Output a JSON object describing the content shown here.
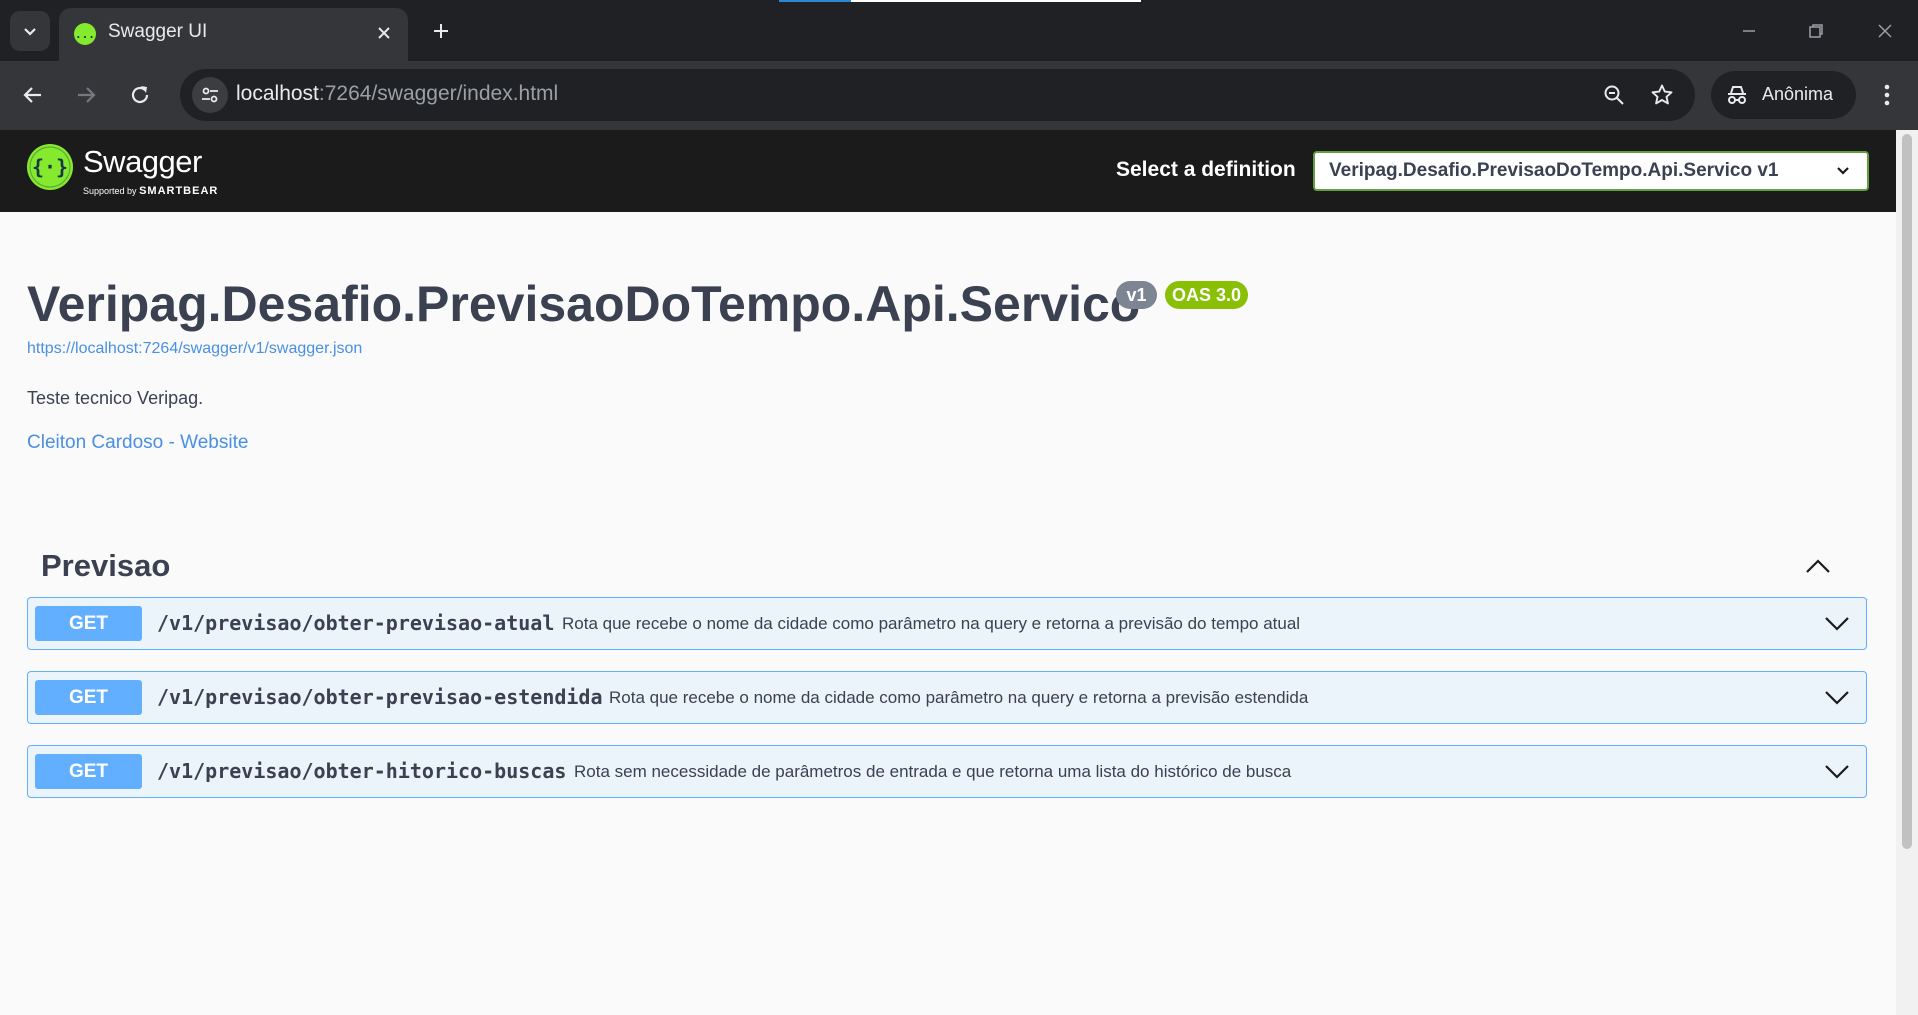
{
  "browser": {
    "tab_title": "Swagger UI",
    "url_host": "localhost",
    "url_rest": ":7264/swagger/index.html",
    "profile_label": "Anônima"
  },
  "swagger": {
    "brand": "Swagger",
    "supported_prefix": "Supported by",
    "supported_company": "SMARTBEAR",
    "select_label": "Select a definition",
    "selected_definition": "Veripag.Desafio.PrevisaoDoTempo.Api.Servico v1"
  },
  "info": {
    "title": "Veripag.Desafio.PrevisaoDoTempo.Api.Servico",
    "version_badge": "v1",
    "oas_badge": "OAS 3.0",
    "json_url": "https://localhost:7264/swagger/v1/swagger.json",
    "description": "Teste tecnico Veripag.",
    "contact": "Cleiton Cardoso - Website"
  },
  "tag": {
    "name": "Previsao",
    "operations": [
      {
        "method": "GET",
        "path": "/v1/previsao/obter-previsao-atual",
        "summary": "Rota que recebe o nome da cidade como parâmetro na query e retorna a previsão do tempo atual"
      },
      {
        "method": "GET",
        "path": "/v1/previsao/obter-previsao-estendida",
        "summary": "Rota que recebe o nome da cidade como parâmetro na query e retorna a previsão estendida"
      },
      {
        "method": "GET",
        "path": "/v1/previsao/obter-hitorico-buscas",
        "summary": "Rota sem necessidade de parâmetros de entrada e que retorna uma lista do histórico de busca"
      }
    ]
  },
  "colors": {
    "get_method": "#61affe",
    "get_background": "#ebf3fb",
    "swagger_green": "#85ea2d",
    "oas_badge": "#89bf04",
    "version_badge": "#7d8492",
    "link": "#4990e2"
  }
}
